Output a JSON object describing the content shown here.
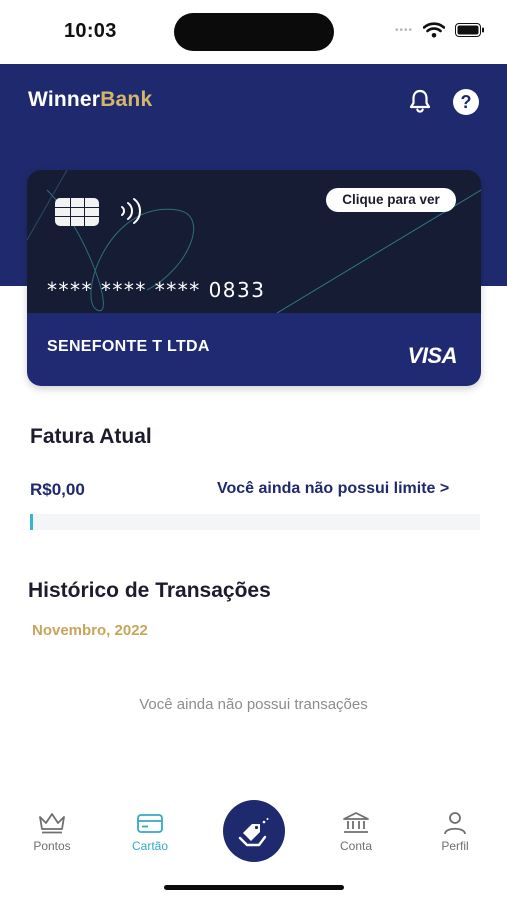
{
  "status_bar": {
    "time": "10:03"
  },
  "header": {
    "brand_primary": "Winner",
    "brand_accent": "Bank",
    "bell_icon": "bell-icon",
    "help_icon": "help-icon"
  },
  "card": {
    "reveal_label": "Clique para ver",
    "number": "**** **** **** 0833",
    "holder": "SENEFONTE T LTDA",
    "network": "VISA"
  },
  "invoice": {
    "title": "Fatura Atual",
    "amount": "R$0,00",
    "limit_link": "Você ainda não possui limite >",
    "progress": 0
  },
  "history": {
    "title": "Histórico de Transações",
    "month": "Novembro, 2022",
    "empty_message": "Você ainda não possui transações"
  },
  "nav": {
    "items": [
      {
        "label": "Pontos",
        "icon": "crown-icon"
      },
      {
        "label": "Cartão",
        "icon": "card-icon",
        "active": true
      },
      {
        "label": "",
        "icon": "tag-hand-icon"
      },
      {
        "label": "Conta",
        "icon": "bank-icon"
      },
      {
        "label": "Perfil",
        "icon": "user-icon"
      }
    ]
  },
  "colors": {
    "navy": "#1f2a6e",
    "gold": "#d4b66a",
    "teal": "#35a9c6",
    "card_dark": "#171c35"
  }
}
